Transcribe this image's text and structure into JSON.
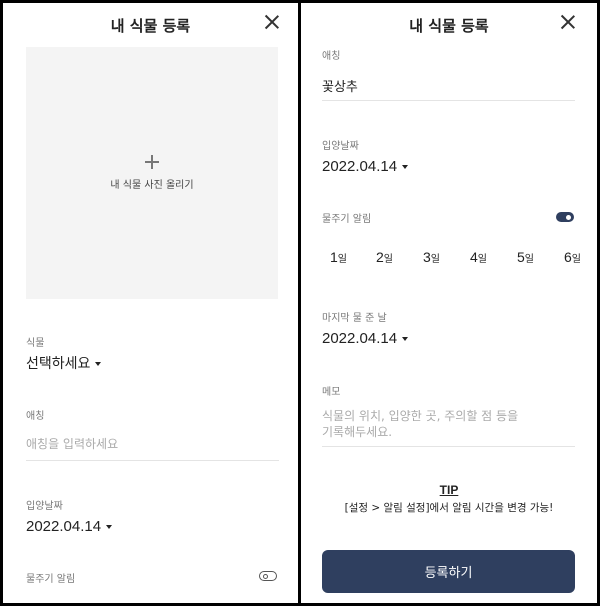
{
  "header": {
    "title": "내 식물 등록"
  },
  "photo": {
    "label": "내 식물 사진 올리기"
  },
  "plant": {
    "label": "식물",
    "value": "선택하세요"
  },
  "nickname": {
    "label": "애칭",
    "placeholder": "애칭을 입력하세요",
    "value": "꽃상추"
  },
  "adoption_date": {
    "label": "입양날짜",
    "value": "2022.04.14"
  },
  "watering_alarm": {
    "label": "물주기 알림",
    "left_state": "off",
    "right_state": "on"
  },
  "interval_days": [
    {
      "num": "1",
      "unit": "일"
    },
    {
      "num": "2",
      "unit": "일"
    },
    {
      "num": "3",
      "unit": "일"
    },
    {
      "num": "4",
      "unit": "일"
    },
    {
      "num": "5",
      "unit": "일"
    },
    {
      "num": "6",
      "unit": "일"
    }
  ],
  "last_watered": {
    "label": "마지막 물 준 날",
    "value": "2022.04.14"
  },
  "memo": {
    "label": "메모",
    "placeholder_line1": "식물의 위치, 입양한 곳, 주의할 점 등을",
    "placeholder_line2": "기록해두세요."
  },
  "tip": {
    "title": "TIP",
    "text": "[설정 > 알림 설정]에서 알림 시간을 변경 가능!"
  },
  "submit_label": "등록하기",
  "colors": {
    "primary": "#2f3f5f",
    "photo_bg": "#f4f4f4",
    "divider": "#e4e4e4"
  }
}
